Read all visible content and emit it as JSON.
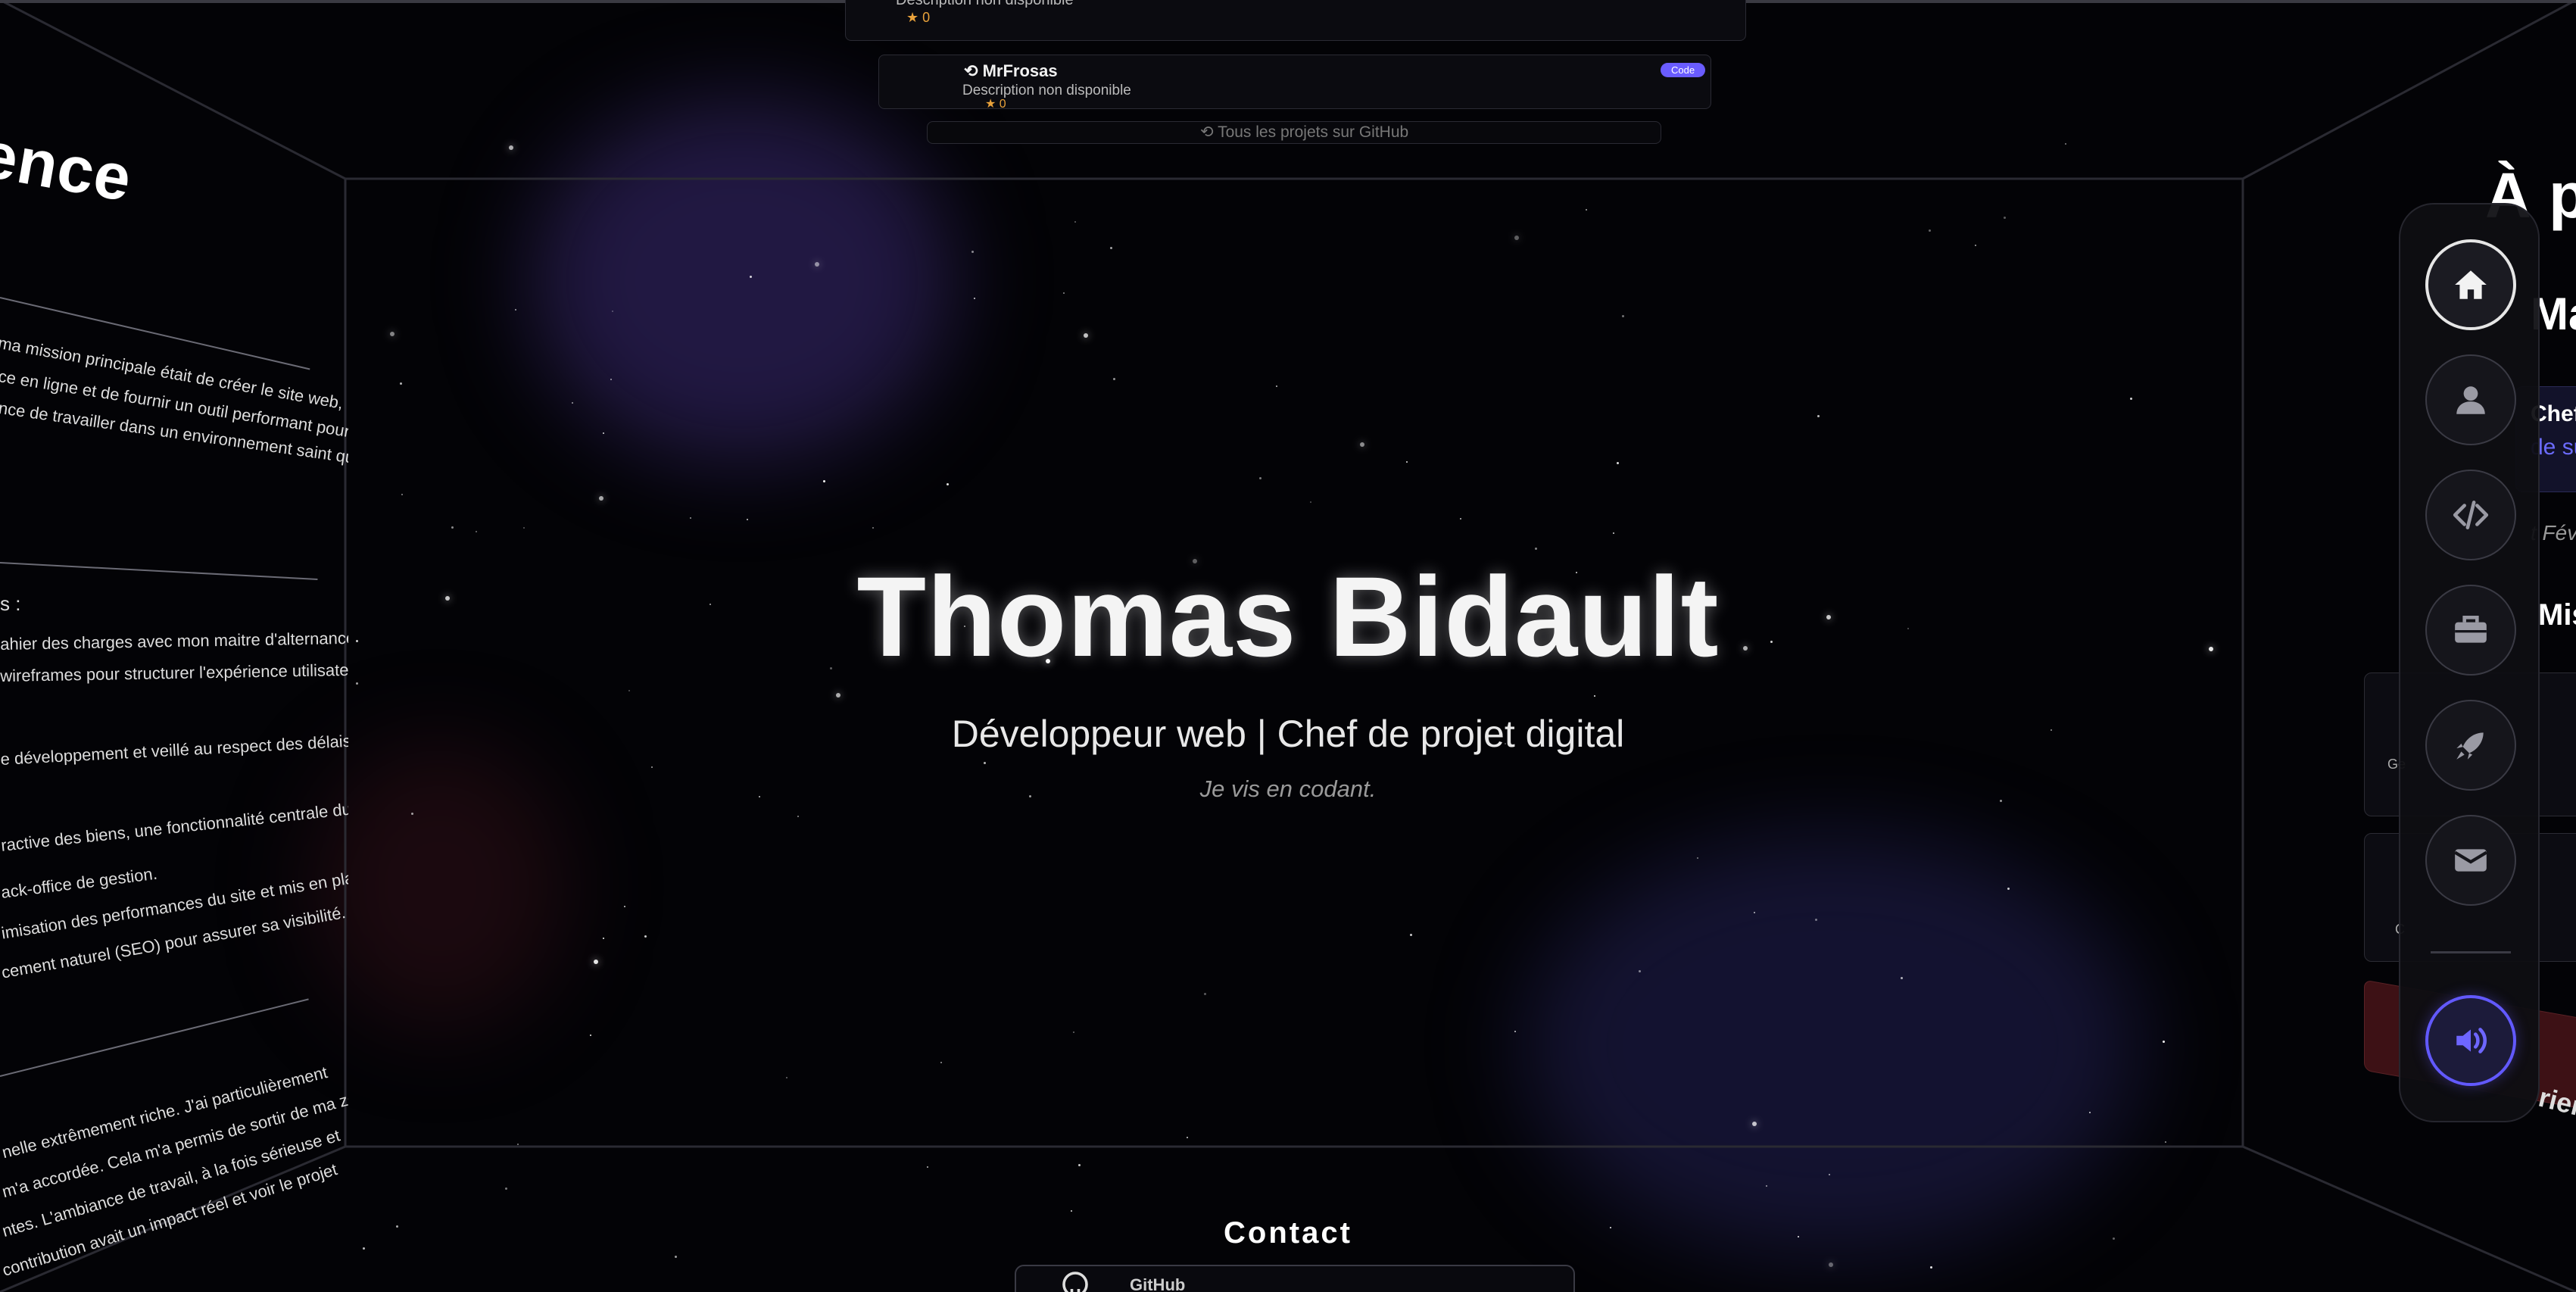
{
  "hero": {
    "name": "Thomas Bidault",
    "subtitle": "Développeur web | Chef de projet digital",
    "tagline": "Je vis en codant."
  },
  "left_wall": {
    "title": "ience",
    "lines": [
      "ma mission principale était de créer le site web,",
      "ce en ligne et de fournir un outil performant pour la",
      "nce de travailler dans un environnement saint qui",
      "s :",
      "ahier des charges avec mon maitre d'alternance, puis",
      "wireframes pour structurer l'expérience utilisateur.",
      "e développement et veillé au respect des délais et de",
      "ractive des biens, une fonctionnalité centrale du site,",
      "ack-office de gestion.",
      "imisation des performances du site et mis en place",
      "cement naturel (SEO) pour assurer sa visibilité.",
      "nelle extrêmement riche. J'ai particulièrement",
      "m'a accordée. Cela m'a permis de sortir de ma zone",
      "ntes. L'ambiance de travail, à la fois sérieuse et",
      "contribution avait un impact réel et voir le projet"
    ]
  },
  "top_wall": {
    "card1_desc": "Description non disponible",
    "card2_title": "MrFrosas",
    "card2_desc": "Description non disponible",
    "card2_badge": "Code",
    "star_count": "0",
    "all_projects": "Tous les projets sur GitHub"
  },
  "bottom_wall": {
    "title": "Contact",
    "github_label": "GitHub"
  },
  "right_wall": {
    "title": "À pro",
    "sub": "Ma",
    "chef": "Chef de",
    "accent": "de su",
    "date": "t Fév",
    "missions": "Missions",
    "small1": "Ge",
    "small2": "C",
    "red_text": "rience"
  },
  "nav": {
    "items": [
      {
        "icon": "home-icon",
        "active": true
      },
      {
        "icon": "user-icon",
        "active": false
      },
      {
        "icon": "code-icon",
        "active": false
      },
      {
        "icon": "briefcase-icon",
        "active": false
      },
      {
        "icon": "rocket-icon",
        "active": false
      },
      {
        "icon": "mail-icon",
        "active": false
      }
    ],
    "sound_icon": "volume-icon",
    "accent_color": "#6259ff"
  },
  "colors": {
    "background": "#030306",
    "star_color": "#e9a23b",
    "badge_color": "#6a5cff"
  }
}
